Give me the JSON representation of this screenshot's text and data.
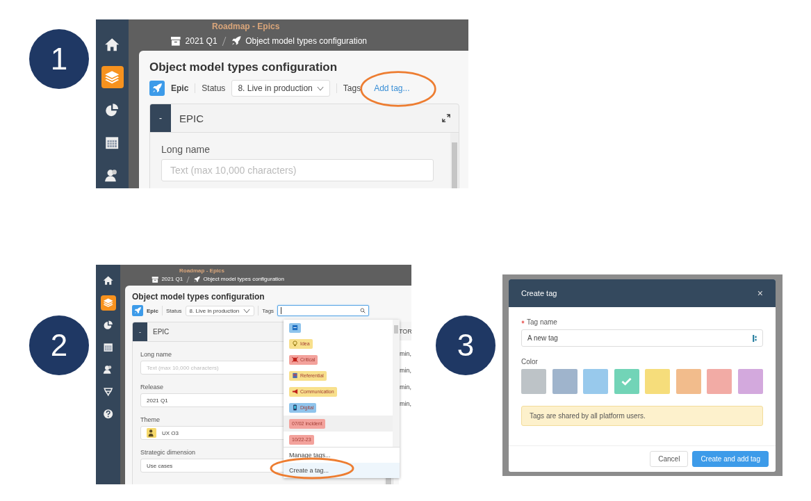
{
  "steps": [
    {
      "number": "1"
    },
    {
      "number": "2"
    },
    {
      "number": "3"
    }
  ],
  "panel1": {
    "nav": [
      {
        "kind": "home",
        "selected": false
      },
      {
        "kind": "layers",
        "selected": true
      },
      {
        "kind": "pie",
        "selected": false
      },
      {
        "kind": "calendar",
        "selected": false
      },
      {
        "kind": "users",
        "selected": false
      }
    ],
    "background_title": "Roadmap - Epics",
    "breadcrumb": [
      "2021 Q1",
      "Object model types configuration"
    ],
    "title": "Object model types configuration",
    "type_label": "Epic",
    "status_label": "Status",
    "status_value": "8. Live in production",
    "tags_label": "Tags",
    "add_tag": "Add tag...",
    "section": {
      "collapse": "-",
      "title": "EPIC"
    },
    "fields": [
      {
        "label": "Long name",
        "placeholder": "Text (max 10,000 characters)"
      }
    ]
  },
  "panel2": {
    "nav": [
      {
        "kind": "home",
        "selected": false
      },
      {
        "kind": "layers",
        "selected": true
      },
      {
        "kind": "pie",
        "selected": false
      },
      {
        "kind": "calendar",
        "selected": false
      },
      {
        "kind": "users",
        "selected": false
      },
      {
        "kind": "network",
        "selected": false
      },
      {
        "kind": "help",
        "selected": false
      }
    ],
    "background_title": "Roadmap - Epics",
    "breadcrumb": [
      "2021 Q1",
      "Object model types configuration"
    ],
    "title": "Object model types configuration",
    "type_label": "Epic",
    "status_label": "Status",
    "status_value": "8. Live in production",
    "tags_label": "Tags",
    "section": {
      "collapse": "-",
      "title": "EPIC"
    },
    "fields": [
      {
        "label": "Long name",
        "placeholder": "Text (max 10,000 characters)"
      },
      {
        "label": "Release",
        "value": "2021 Q1"
      },
      {
        "label": "Theme",
        "value": "UX O3",
        "kind": "person"
      },
      {
        "label": "Strategic dimension",
        "value": "Use cases"
      }
    ],
    "side_column": {
      "header": "TOR",
      "cells": [
        "min,",
        "min,",
        "min,",
        "min,"
      ]
    },
    "tags": [
      {
        "kind": "card",
        "color": "#8fc4ec",
        "hovered": false
      },
      {
        "label": "Idea",
        "kind": "bulb",
        "color": "#f8e08c",
        "hovered": false
      },
      {
        "label": "Critical",
        "kind": "bug",
        "color": "#f3a29c",
        "hovered": false
      },
      {
        "label": "Referential",
        "kind": "book",
        "color": "#f8e08c",
        "hovered": false
      },
      {
        "label": "Communication",
        "kind": "megaphone",
        "color": "#f8e08c",
        "hovered": false
      },
      {
        "label": "Digital",
        "kind": "phone",
        "color": "#8fc4ec",
        "hovered": false
      },
      {
        "label": "07/02 incident",
        "color": "#f3a29c",
        "hovered": true
      },
      {
        "label": "10/22-23",
        "color": "#f3a29c",
        "hovered": false
      }
    ],
    "actions": [
      {
        "label": "Manage tags...",
        "hovered": false
      },
      {
        "label": "Create a tag...",
        "hovered": true
      }
    ]
  },
  "panel3": {
    "title": "Create tag",
    "close": "×",
    "name_label": "Tag name",
    "required": true,
    "name_value": "A new tag",
    "color_label": "Color",
    "swatches": [
      {
        "color": "#bdc3c7",
        "selected": false
      },
      {
        "color": "#9fb4cc",
        "selected": false
      },
      {
        "color": "#98c9ec",
        "selected": false
      },
      {
        "color": "#72d4b7",
        "selected": true
      },
      {
        "color": "#f6dd7b",
        "selected": false
      },
      {
        "color": "#f2bc8c",
        "selected": false
      },
      {
        "color": "#f2aba5",
        "selected": false
      },
      {
        "color": "#d3a9dd",
        "selected": false
      }
    ],
    "notice": "Tags are shared by all platform users.",
    "cancel": "Cancel",
    "submit": "Create and add tag"
  }
}
